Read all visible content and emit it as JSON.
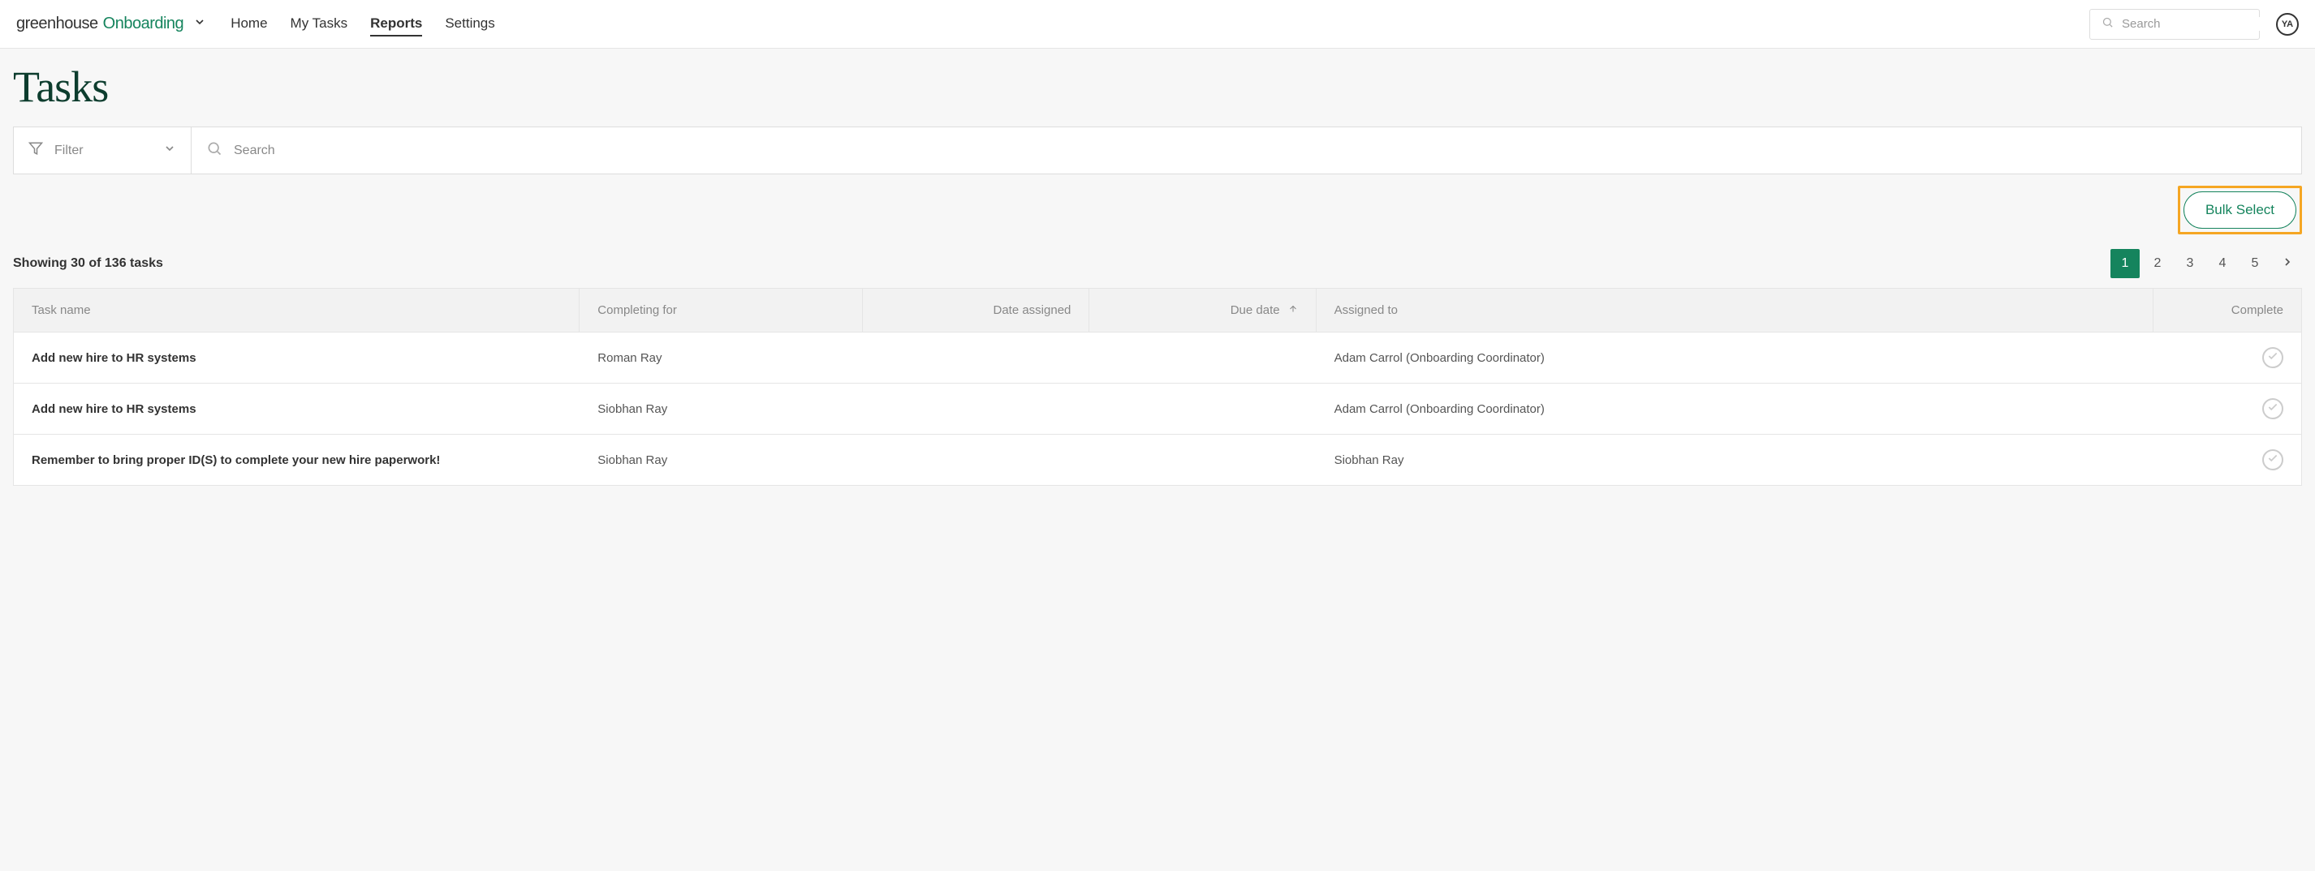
{
  "brand": {
    "primary": "greenhouse",
    "secondary": "Onboarding"
  },
  "nav": {
    "items": [
      {
        "label": "Home",
        "active": false
      },
      {
        "label": "My Tasks",
        "active": false
      },
      {
        "label": "Reports",
        "active": true
      },
      {
        "label": "Settings",
        "active": false
      }
    ]
  },
  "global_search": {
    "placeholder": "Search"
  },
  "user": {
    "initials": "YA"
  },
  "page": {
    "title": "Tasks"
  },
  "filter": {
    "label": "Filter"
  },
  "search": {
    "placeholder": "Search"
  },
  "bulk_select": {
    "label": "Bulk Select"
  },
  "result_summary": "Showing 30 of 136 tasks",
  "pagination": {
    "pages": [
      "1",
      "2",
      "3",
      "4",
      "5"
    ],
    "active_index": 0
  },
  "table": {
    "columns": {
      "task_name": "Task name",
      "completing_for": "Completing for",
      "date_assigned": "Date assigned",
      "due_date": "Due date",
      "assigned_to": "Assigned to",
      "complete": "Complete"
    },
    "rows": [
      {
        "task_name": "Add new hire to HR systems",
        "completing_for": "Roman Ray",
        "date_assigned": "",
        "due_date": "",
        "assigned_to": "Adam Carrol (Onboarding Coordinator)"
      },
      {
        "task_name": "Add new hire to HR systems",
        "completing_for": "Siobhan Ray",
        "date_assigned": "",
        "due_date": "",
        "assigned_to": "Adam Carrol (Onboarding Coordinator)"
      },
      {
        "task_name": "Remember to bring proper ID(S) to complete your new hire paperwork!",
        "completing_for": "Siobhan Ray",
        "date_assigned": "",
        "due_date": "",
        "assigned_to": "Siobhan Ray"
      }
    ]
  }
}
